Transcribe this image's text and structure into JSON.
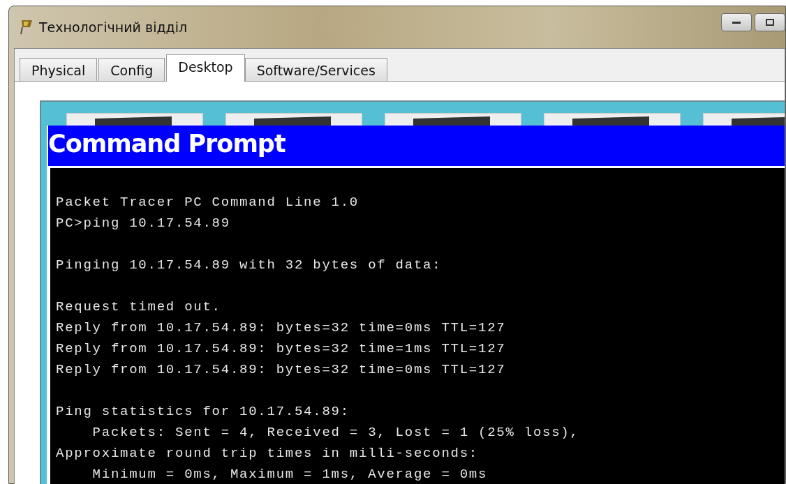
{
  "window": {
    "title": "Технологічний відділ"
  },
  "tabs": [
    {
      "label": "Physical",
      "selected": false
    },
    {
      "label": "Config",
      "selected": false
    },
    {
      "label": "Desktop",
      "selected": true
    },
    {
      "label": "Software/Services",
      "selected": false
    }
  ],
  "command_prompt": {
    "title": "Command Prompt",
    "blocks": [
      [
        "Packet Tracer PC Command Line 1.0",
        "PC>ping 10.17.54.89"
      ],
      [
        "Pinging 10.17.54.89 with 32 bytes of data:"
      ],
      [
        "Request timed out.",
        "Reply from 10.17.54.89: bytes=32 time=0ms TTL=127",
        "Reply from 10.17.54.89: bytes=32 time=1ms TTL=127",
        "Reply from 10.17.54.89: bytes=32 time=0ms TTL=127"
      ],
      [
        "Ping statistics for 10.17.54.89:",
        "    Packets: Sent = 4, Received = 3, Lost = 1 (25% loss),",
        "Approximate round trip times in milli-seconds:",
        "    Minimum = 0ms, Maximum = 1ms, Average = 0ms"
      ]
    ]
  }
}
